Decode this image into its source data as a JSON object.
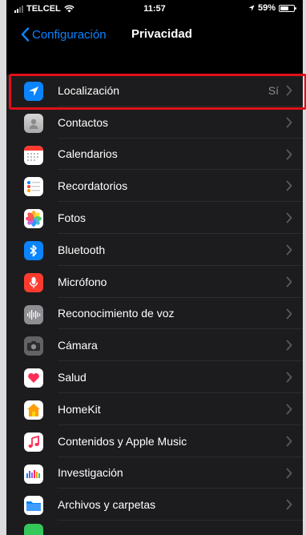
{
  "status_bar": {
    "carrier": "TELCEL",
    "time": "11:57",
    "battery_percent": "59%"
  },
  "nav": {
    "back_label": "Configuración",
    "title": "Privacidad"
  },
  "rows": [
    {
      "label": "Localización",
      "value": "Sí",
      "icon": "location-arrow-icon",
      "color": "#0a84ff"
    },
    {
      "label": "Contactos",
      "value": "",
      "icon": "contacts-icon",
      "color": "#c7c7cc"
    },
    {
      "label": "Calendarios",
      "value": "",
      "icon": "calendar-icon",
      "color": "#ffffff"
    },
    {
      "label": "Recordatorios",
      "value": "",
      "icon": "reminders-icon",
      "color": "#ffffff"
    },
    {
      "label": "Fotos",
      "value": "",
      "icon": "photos-icon",
      "color": "#ffffff"
    },
    {
      "label": "Bluetooth",
      "value": "",
      "icon": "bluetooth-icon",
      "color": "#0a84ff"
    },
    {
      "label": "Micrófono",
      "value": "",
      "icon": "microphone-icon",
      "color": "#ff3b30"
    },
    {
      "label": "Reconocimiento de voz",
      "value": "",
      "icon": "speech-recognition-icon",
      "color": "#8e8e93"
    },
    {
      "label": "Cámara",
      "value": "",
      "icon": "camera-icon",
      "color": "#636366"
    },
    {
      "label": "Salud",
      "value": "",
      "icon": "health-icon",
      "color": "#ffffff"
    },
    {
      "label": "HomeKit",
      "value": "",
      "icon": "homekit-icon",
      "color": "#ff9f0a"
    },
    {
      "label": "Contenidos y Apple Music",
      "value": "",
      "icon": "music-icon",
      "color": "#ffffff"
    },
    {
      "label": "Investigación",
      "value": "",
      "icon": "research-icon",
      "color": "#ffffff"
    },
    {
      "label": "Archivos y carpetas",
      "value": "",
      "icon": "files-folder-icon",
      "color": "#0a84ff"
    }
  ],
  "highlight_color": "#e0101a"
}
